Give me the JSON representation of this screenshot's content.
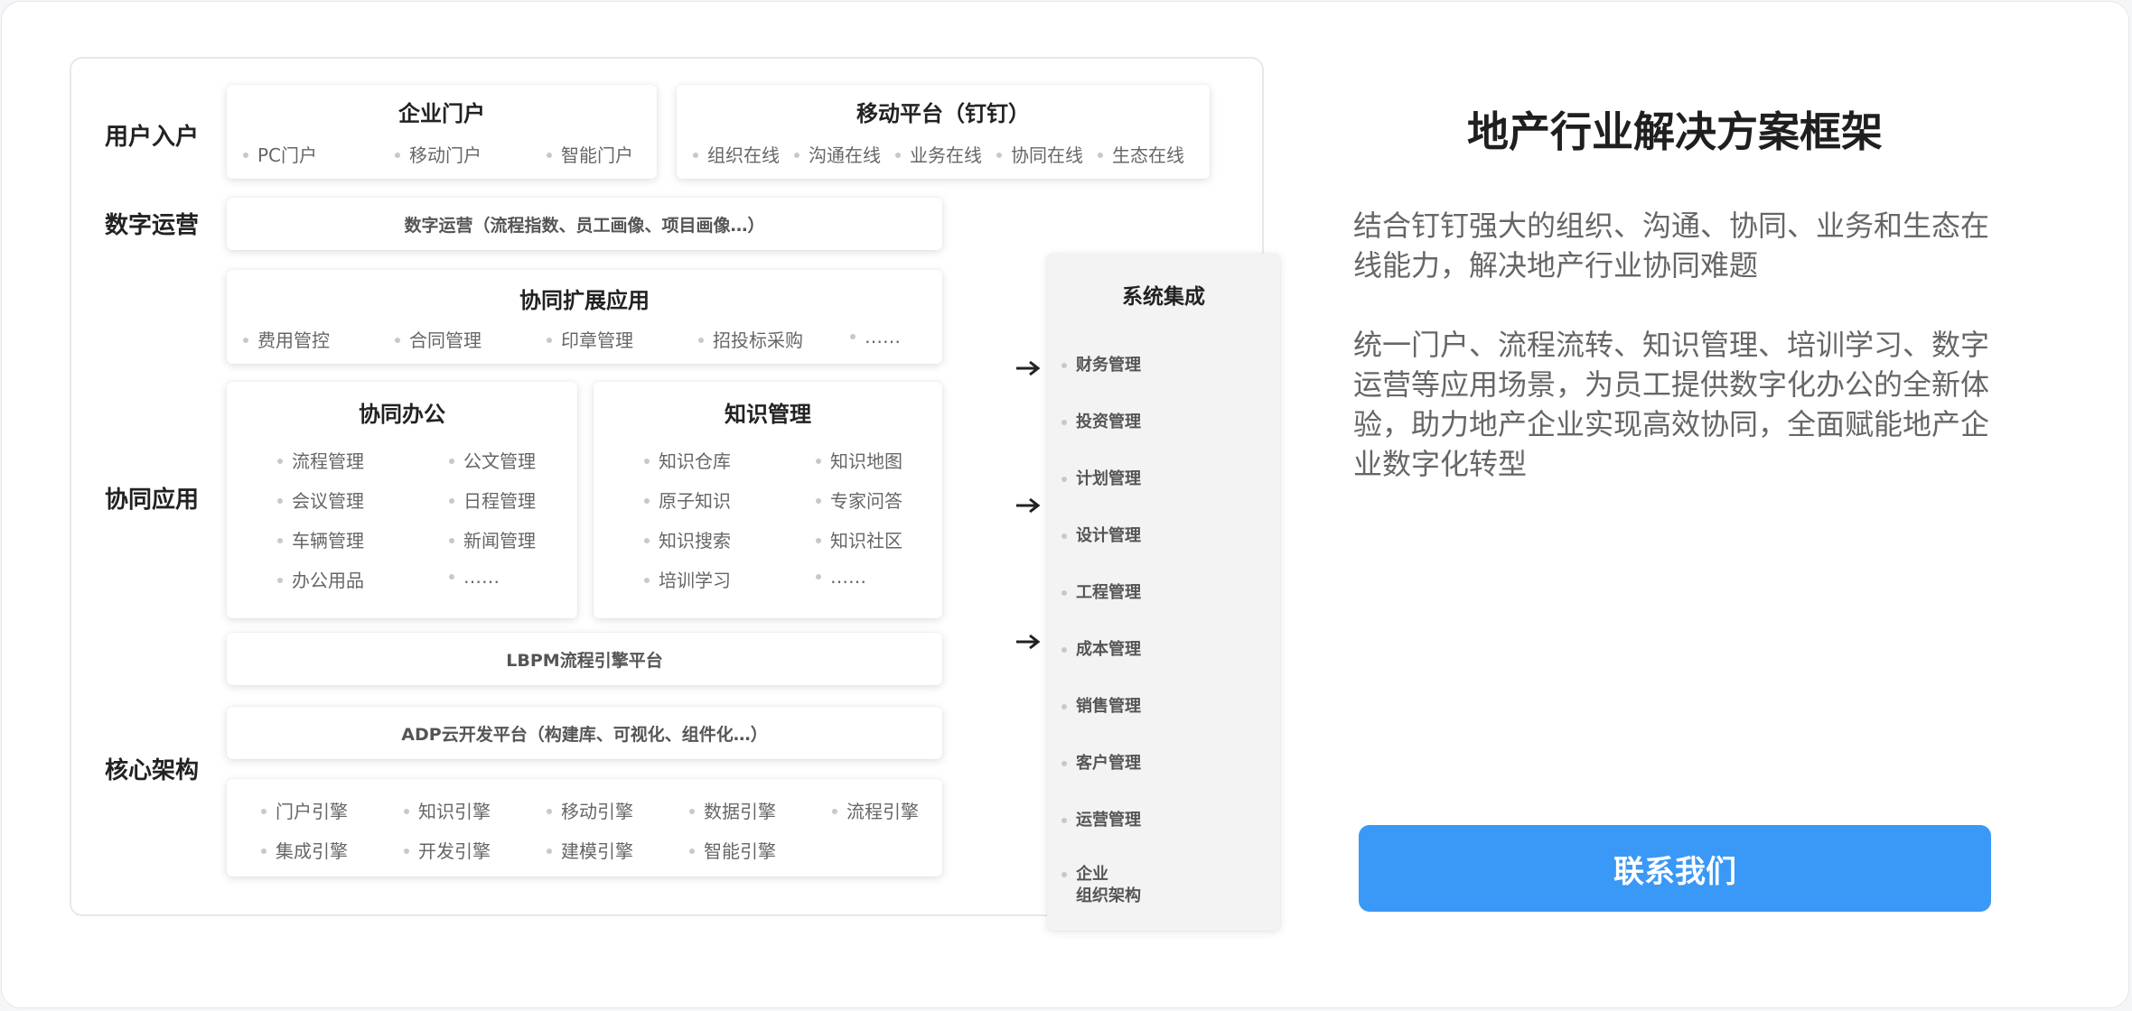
{
  "row_labels": {
    "user_entry": "用户入户",
    "digital_ops": "数字运营",
    "collab_apps": "协同应用",
    "core_arch": "核心架构"
  },
  "enterprise_portal": {
    "title": "企业门户",
    "items": [
      "PC门户",
      "移动门户",
      "智能门户"
    ]
  },
  "mobile_platform": {
    "title": "移动平台（钉钉）",
    "items": [
      "组织在线",
      "沟通在线",
      "业务在线",
      "协同在线",
      "生态在线"
    ]
  },
  "digital_ops_box": "数字运营（流程指数、员工画像、项目画像…）",
  "collab_ext": {
    "title": "协同扩展应用",
    "items": [
      "费用管控",
      "合同管理",
      "印章管理",
      "招投标采购",
      "……"
    ]
  },
  "collab_office": {
    "title": "协同办公",
    "items": [
      "流程管理",
      "公文管理",
      "会议管理",
      "日程管理",
      "车辆管理",
      "新闻管理",
      "办公用品",
      "……"
    ]
  },
  "knowledge_mgmt": {
    "title": "知识管理",
    "items": [
      "知识仓库",
      "知识地图",
      "原子知识",
      "专家问答",
      "知识搜索",
      "知识社区",
      "培训学习",
      "……"
    ]
  },
  "lbpm_box": "LBPM流程引擎平台",
  "adp_box": "ADP云开发平台（构建库、可视化、组件化…）",
  "engines": [
    "门户引擎",
    "知识引擎",
    "移动引擎",
    "数据引擎",
    "流程引擎",
    "集成引擎",
    "开发引擎",
    "建模引擎",
    "智能引擎"
  ],
  "system_integration": {
    "title": "系统集成",
    "items": [
      "财务管理",
      "投资管理",
      "计划管理",
      "设计管理",
      "工程管理",
      "成本管理",
      "销售管理",
      "客户管理",
      "运营管理",
      "企业\n组织架构"
    ]
  },
  "right_panel": {
    "heading": "地产行业解决方案框架",
    "para1": "结合钉钉强大的组织、沟通、协同、业务和生态在线能力，解决地产行业协同难题",
    "para2": "统一门户、流程流转、知识管理、培训学习、数字运营等应用场景，为员工提供数字化办公的全新体验，助力地产企业实现高效协同，全面赋能地产企业数字化转型",
    "cta_label": "联系我们"
  },
  "colors": {
    "accent": "#3a98f6"
  }
}
